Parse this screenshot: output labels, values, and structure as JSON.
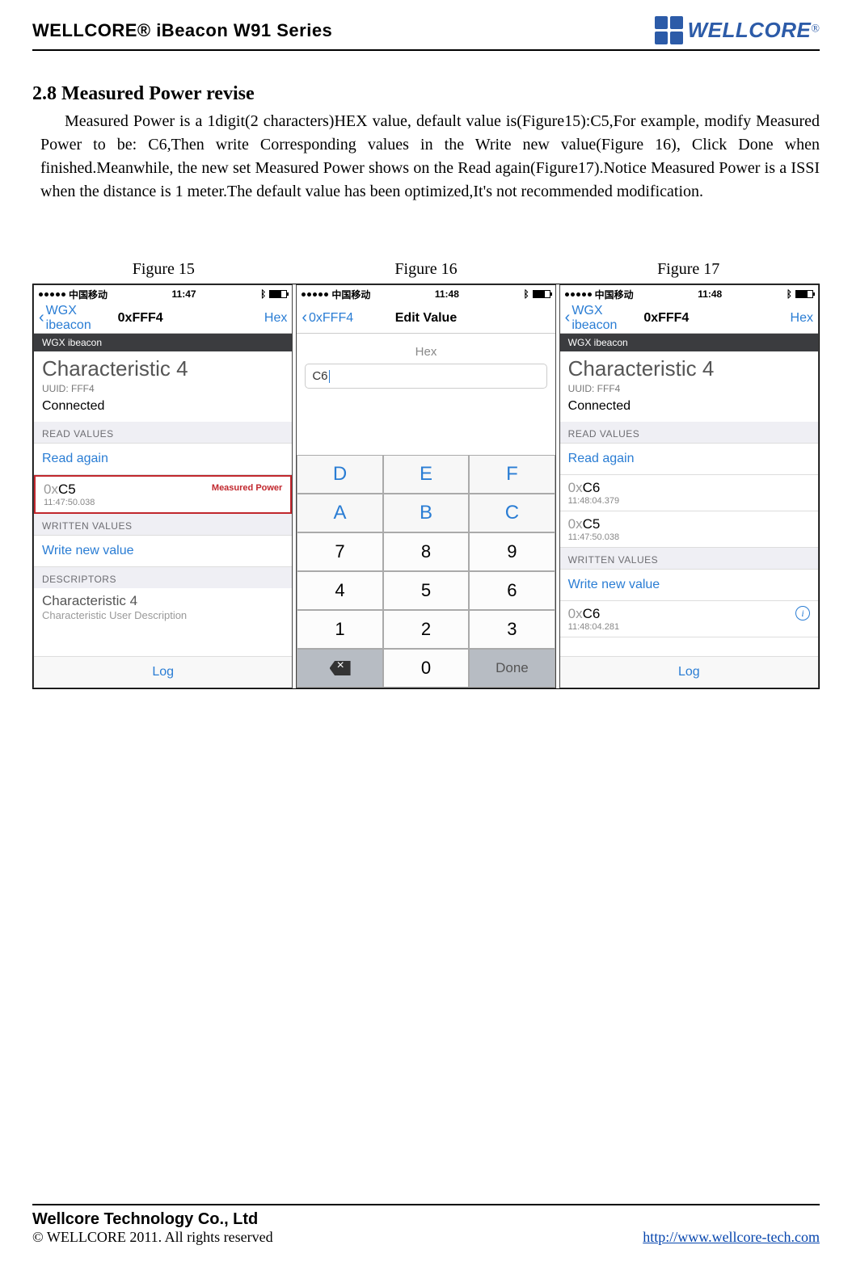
{
  "header": {
    "title": "WELLCORE® iBeacon W91 Series",
    "logo_text": "WELLCORE",
    "logo_reg": "®"
  },
  "section": {
    "number_title": "2.8    Measured Power revise",
    "body": "Measured Power is a 1digit(2 characters)HEX value, default value is(Figure15):C5,For example, modify Measured Power to be: C6,Then write Corresponding values in the Write new value(Figure 16), Click Done when finished.Meanwhile, the new set Measured Power shows on the Read again(Figure17).Notice Measured Power is a ISSI when the distance is 1 meter.The default value has been optimized,It's not recommended modification."
  },
  "figures": {
    "f15": "Figure  15",
    "f16": "Figure  16",
    "f17": "Figure  17"
  },
  "phone_common": {
    "carrier": "中国移动",
    "bt": "✱",
    "device": "WGX ibeacon",
    "char_label": "Characteristic 4",
    "uuid": "UUID: FFF4",
    "connected": "Connected",
    "read_values_h": "READ VALUES",
    "read_again": "Read again",
    "written_values_h": "WRITTEN VALUES",
    "write_new": "Write new value",
    "descriptors_h": "DESCRIPTORS",
    "desc_label": "Characteristic 4",
    "desc_sub": "Characteristic User Description",
    "log": "Log",
    "hex": "Hex",
    "back": "WGX ibeacon",
    "back_bold": "0xFFF4"
  },
  "fig15": {
    "time": "11:47",
    "value_prefix": "0x",
    "value": "C5",
    "ts": "11:47:50.038",
    "measured_label": "Measured Power"
  },
  "fig16": {
    "time": "11:48",
    "nav_back": "0xFFF4",
    "nav_title": "Edit Value",
    "hex_label": "Hex",
    "input_value": "C6",
    "keys_letters": [
      "D",
      "E",
      "F",
      "A",
      "B",
      "C"
    ],
    "keys_nums": [
      "7",
      "8",
      "9",
      "4",
      "5",
      "6",
      "1",
      "2",
      "3"
    ],
    "key_zero": "0",
    "done": "Done"
  },
  "fig17": {
    "time": "11:48",
    "val1_prefix": "0x",
    "val1": "C6",
    "ts1": "11:48:04.379",
    "val2_prefix": "0x",
    "val2": "C5",
    "ts2": "11:47:50.038",
    "wrote_prefix": "0x",
    "wrote": "C6",
    "wrote_ts": "11:48:04.281"
  },
  "footer": {
    "company": "Wellcore Technology Co., Ltd",
    "copyright": "© WELLCORE 2011. All rights reserved",
    "url": "http://www.wellcore-tech.com"
  }
}
